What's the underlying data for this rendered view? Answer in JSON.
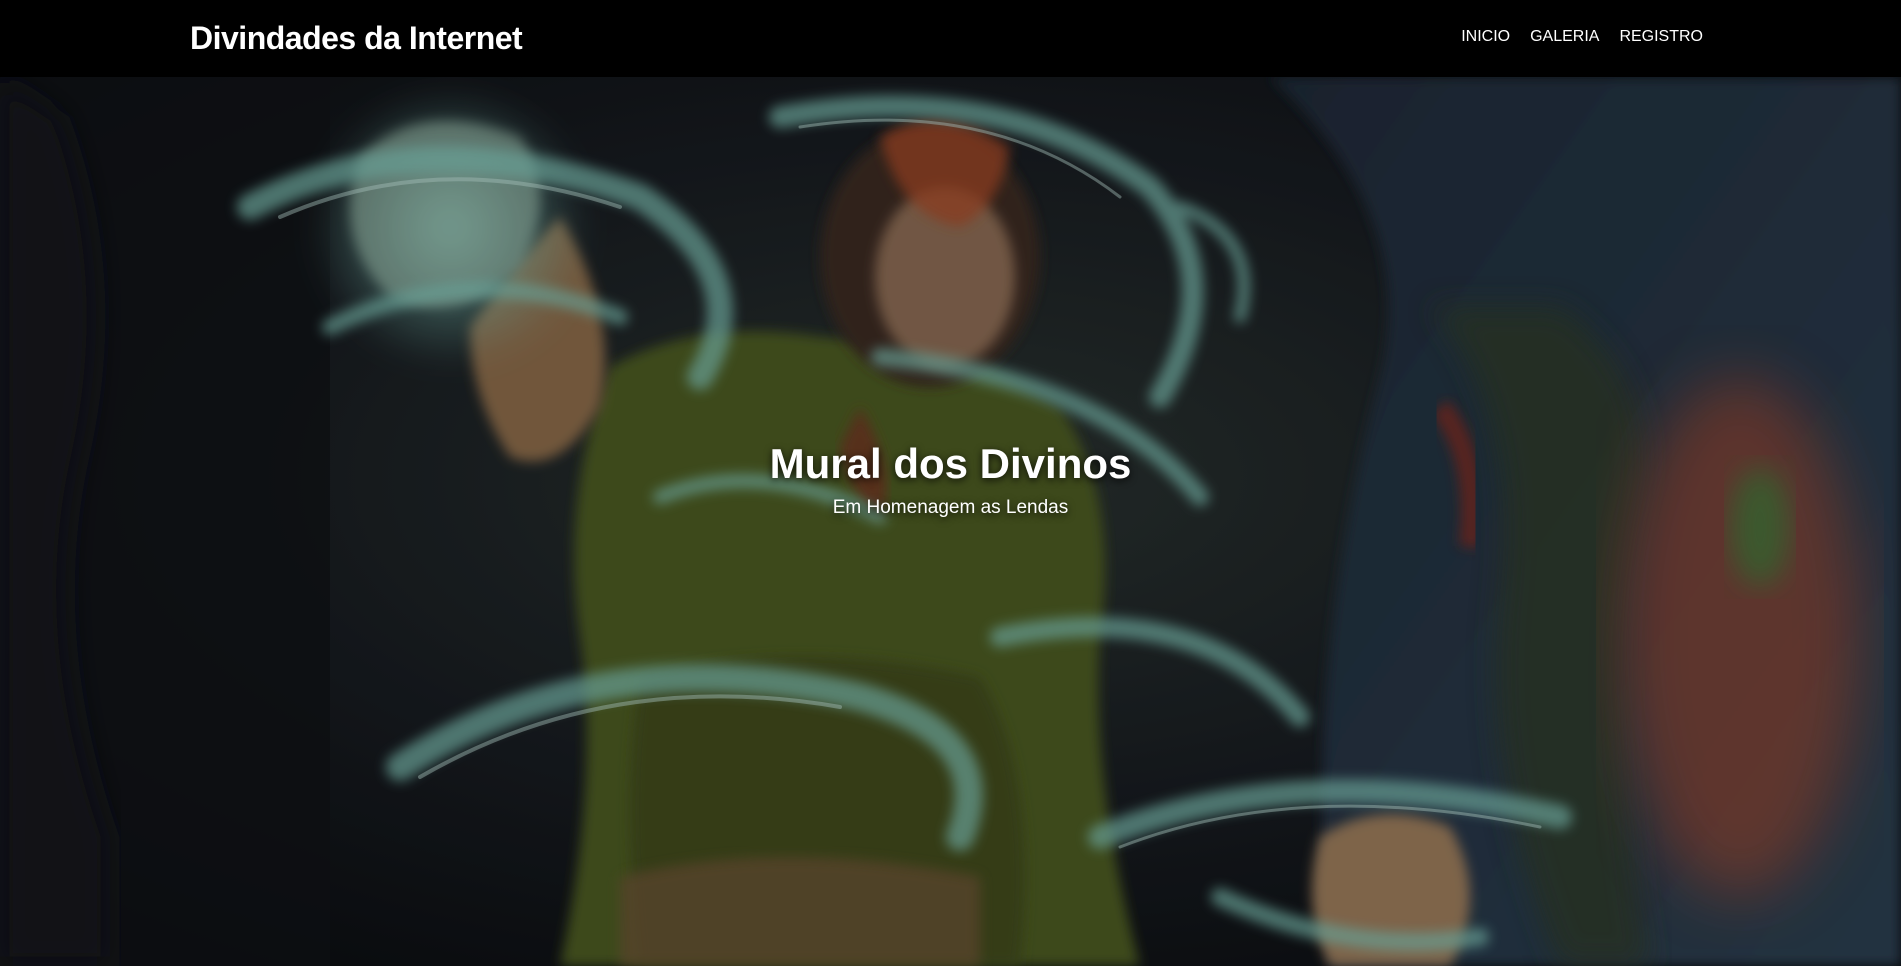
{
  "navbar": {
    "brand": "Divindades da Internet",
    "links": [
      {
        "label": "INICIO"
      },
      {
        "label": "GALERIA"
      },
      {
        "label": "REGISTRO"
      }
    ],
    "background": "#000000"
  },
  "hero": {
    "title": "Mural dos Divinos",
    "subtitle": "Em Homenagem as Lendas",
    "background_image": "painted-artwork-swirling-spirit-figure"
  },
  "colors": {
    "text": "#ffffff",
    "hero_base": "#1a1e24",
    "swirl": "#6fb3a8",
    "figure_shirt": "#5a6a2a"
  }
}
